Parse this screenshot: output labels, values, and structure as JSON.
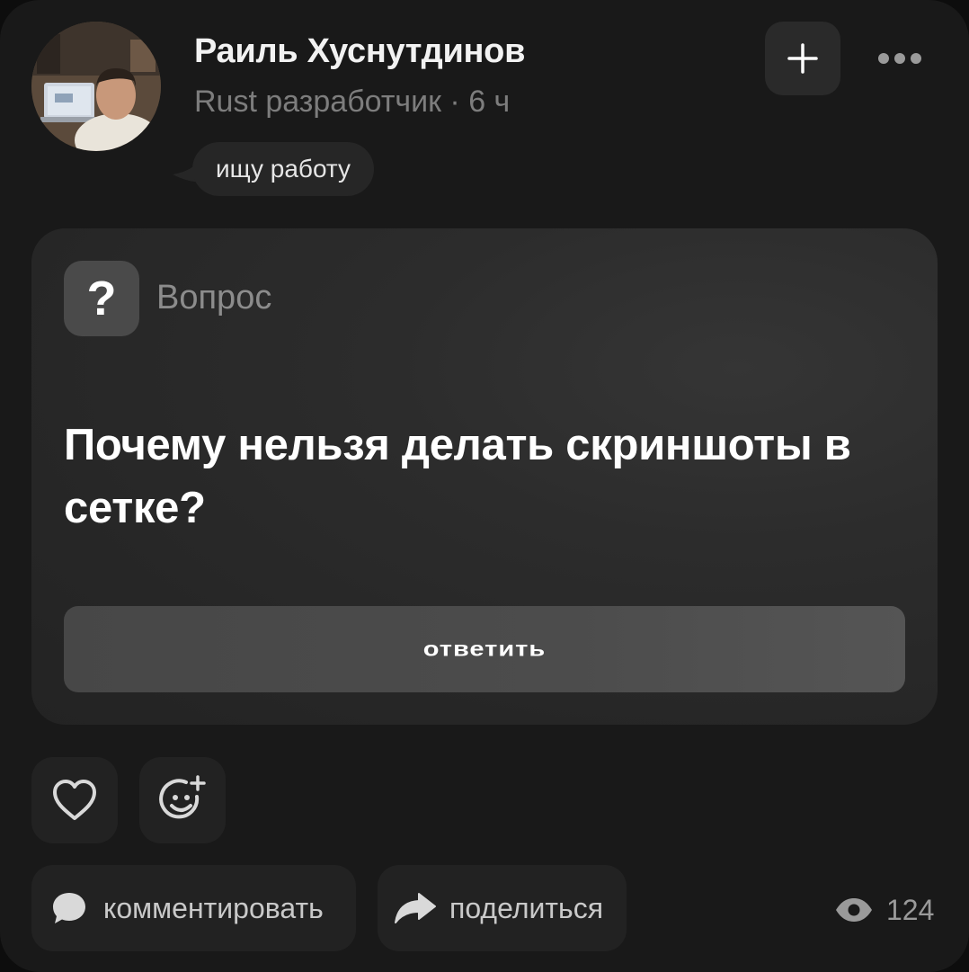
{
  "post": {
    "author": {
      "name": "Раиль Хуснутдинов",
      "meta": "Rust разработчик · 6 ч",
      "status": "ищу работу"
    },
    "question": {
      "label": "Вопрос",
      "icon_glyph": "?",
      "title": "Почему нельзя делать скриншоты в сетке?",
      "answer_label": "ответить"
    },
    "actions": {
      "like_icon": "heart-icon",
      "react_icon": "add-reaction-icon",
      "comment_label": "комментировать",
      "share_label": "поделиться",
      "views_count": "124"
    },
    "header_icons": {
      "add": "plus-icon",
      "more": "more-dots-icon"
    }
  },
  "colors": {
    "background": "#191919",
    "card": "#262626",
    "button": "#222222",
    "muted_text": "#7d7d7d"
  }
}
